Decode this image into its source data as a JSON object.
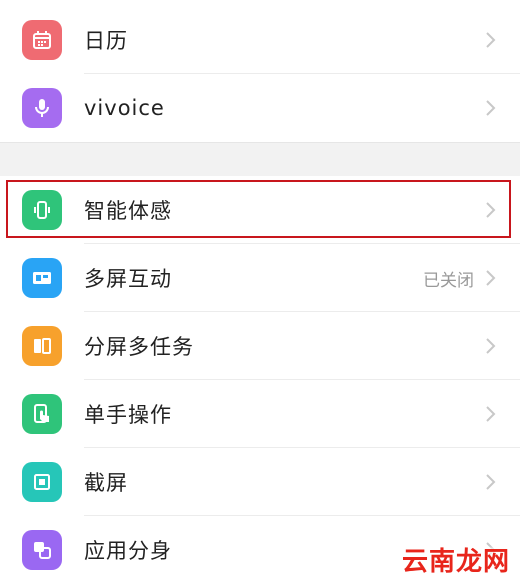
{
  "colors": {
    "calendar": "#ef6b72",
    "vivoice": "#a56cf0",
    "smart_motion": "#2fc47a",
    "multi_screen": "#29a4f5",
    "split_screen": "#f7a12c",
    "one_hand": "#2fc47a",
    "screenshot": "#26c6b8",
    "app_clone": "#9a68f2",
    "highlight_border": "#c8161d"
  },
  "group1": {
    "items": [
      {
        "label": "日历",
        "icon": "calendar-icon"
      },
      {
        "label": "vivoice",
        "icon": "microphone-icon"
      }
    ]
  },
  "group2": {
    "items": [
      {
        "label": "智能体感",
        "icon": "phone-motion-icon"
      },
      {
        "label": "多屏互动",
        "icon": "screen-cast-icon",
        "status": "已关闭"
      },
      {
        "label": "分屏多任务",
        "icon": "split-screen-icon"
      },
      {
        "label": "单手操作",
        "icon": "hand-tap-icon"
      },
      {
        "label": "截屏",
        "icon": "screenshot-icon"
      },
      {
        "label": "应用分身",
        "icon": "app-clone-icon"
      }
    ]
  },
  "watermark": "云南龙网"
}
